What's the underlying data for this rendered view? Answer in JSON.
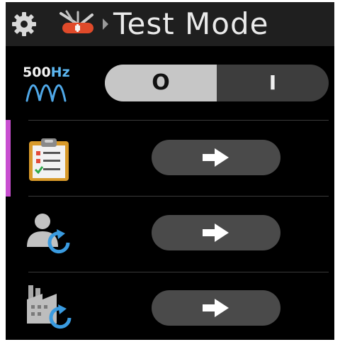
{
  "header": {
    "title": "Test Mode",
    "icons": [
      "gear-icon",
      "swiss-knife-icon",
      "breadcrumb-arrow-icon"
    ]
  },
  "frequency_row": {
    "label_number": "500",
    "label_unit": "Hz",
    "icon": "sine-wave-icon",
    "toggle": {
      "off_label": "O",
      "on_label": "I",
      "selected": "off"
    }
  },
  "action_rows": [
    {
      "icon": "clipboard-checklist-icon",
      "button_icon": "arrow-right-icon",
      "selected": true
    },
    {
      "icon": "user-reset-icon",
      "button_icon": "arrow-right-icon",
      "selected": false
    },
    {
      "icon": "factory-reset-icon",
      "button_icon": "arrow-right-icon",
      "selected": false
    }
  ],
  "colors": {
    "background": "#000000",
    "header": "#1f1f1f",
    "accent": "#c84fd0",
    "hz_unit": "#5cb6f0",
    "toggle_off": "#c6c6c6",
    "toggle_on": "#3d3d3d",
    "button": "#4a4a4a"
  }
}
